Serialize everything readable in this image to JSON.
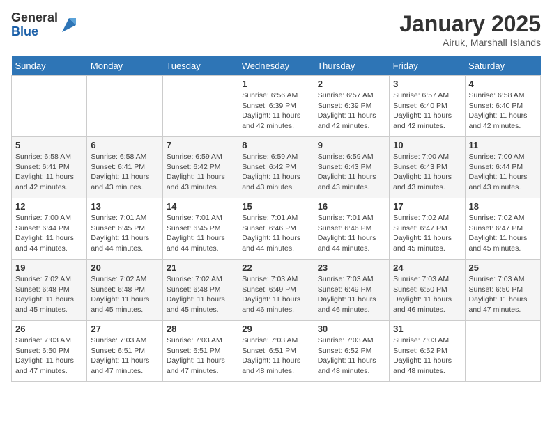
{
  "header": {
    "logo_general": "General",
    "logo_blue": "Blue",
    "month_title": "January 2025",
    "location": "Airuk, Marshall Islands"
  },
  "days_of_week": [
    "Sunday",
    "Monday",
    "Tuesday",
    "Wednesday",
    "Thursday",
    "Friday",
    "Saturday"
  ],
  "weeks": [
    [
      {
        "day": "",
        "info": ""
      },
      {
        "day": "",
        "info": ""
      },
      {
        "day": "",
        "info": ""
      },
      {
        "day": "1",
        "info": "Sunrise: 6:56 AM\nSunset: 6:39 PM\nDaylight: 11 hours and 42 minutes."
      },
      {
        "day": "2",
        "info": "Sunrise: 6:57 AM\nSunset: 6:39 PM\nDaylight: 11 hours and 42 minutes."
      },
      {
        "day": "3",
        "info": "Sunrise: 6:57 AM\nSunset: 6:40 PM\nDaylight: 11 hours and 42 minutes."
      },
      {
        "day": "4",
        "info": "Sunrise: 6:58 AM\nSunset: 6:40 PM\nDaylight: 11 hours and 42 minutes."
      }
    ],
    [
      {
        "day": "5",
        "info": "Sunrise: 6:58 AM\nSunset: 6:41 PM\nDaylight: 11 hours and 42 minutes."
      },
      {
        "day": "6",
        "info": "Sunrise: 6:58 AM\nSunset: 6:41 PM\nDaylight: 11 hours and 43 minutes."
      },
      {
        "day": "7",
        "info": "Sunrise: 6:59 AM\nSunset: 6:42 PM\nDaylight: 11 hours and 43 minutes."
      },
      {
        "day": "8",
        "info": "Sunrise: 6:59 AM\nSunset: 6:42 PM\nDaylight: 11 hours and 43 minutes."
      },
      {
        "day": "9",
        "info": "Sunrise: 6:59 AM\nSunset: 6:43 PM\nDaylight: 11 hours and 43 minutes."
      },
      {
        "day": "10",
        "info": "Sunrise: 7:00 AM\nSunset: 6:43 PM\nDaylight: 11 hours and 43 minutes."
      },
      {
        "day": "11",
        "info": "Sunrise: 7:00 AM\nSunset: 6:44 PM\nDaylight: 11 hours and 43 minutes."
      }
    ],
    [
      {
        "day": "12",
        "info": "Sunrise: 7:00 AM\nSunset: 6:44 PM\nDaylight: 11 hours and 44 minutes."
      },
      {
        "day": "13",
        "info": "Sunrise: 7:01 AM\nSunset: 6:45 PM\nDaylight: 11 hours and 44 minutes."
      },
      {
        "day": "14",
        "info": "Sunrise: 7:01 AM\nSunset: 6:45 PM\nDaylight: 11 hours and 44 minutes."
      },
      {
        "day": "15",
        "info": "Sunrise: 7:01 AM\nSunset: 6:46 PM\nDaylight: 11 hours and 44 minutes."
      },
      {
        "day": "16",
        "info": "Sunrise: 7:01 AM\nSunset: 6:46 PM\nDaylight: 11 hours and 44 minutes."
      },
      {
        "day": "17",
        "info": "Sunrise: 7:02 AM\nSunset: 6:47 PM\nDaylight: 11 hours and 45 minutes."
      },
      {
        "day": "18",
        "info": "Sunrise: 7:02 AM\nSunset: 6:47 PM\nDaylight: 11 hours and 45 minutes."
      }
    ],
    [
      {
        "day": "19",
        "info": "Sunrise: 7:02 AM\nSunset: 6:48 PM\nDaylight: 11 hours and 45 minutes."
      },
      {
        "day": "20",
        "info": "Sunrise: 7:02 AM\nSunset: 6:48 PM\nDaylight: 11 hours and 45 minutes."
      },
      {
        "day": "21",
        "info": "Sunrise: 7:02 AM\nSunset: 6:48 PM\nDaylight: 11 hours and 45 minutes."
      },
      {
        "day": "22",
        "info": "Sunrise: 7:03 AM\nSunset: 6:49 PM\nDaylight: 11 hours and 46 minutes."
      },
      {
        "day": "23",
        "info": "Sunrise: 7:03 AM\nSunset: 6:49 PM\nDaylight: 11 hours and 46 minutes."
      },
      {
        "day": "24",
        "info": "Sunrise: 7:03 AM\nSunset: 6:50 PM\nDaylight: 11 hours and 46 minutes."
      },
      {
        "day": "25",
        "info": "Sunrise: 7:03 AM\nSunset: 6:50 PM\nDaylight: 11 hours and 47 minutes."
      }
    ],
    [
      {
        "day": "26",
        "info": "Sunrise: 7:03 AM\nSunset: 6:50 PM\nDaylight: 11 hours and 47 minutes."
      },
      {
        "day": "27",
        "info": "Sunrise: 7:03 AM\nSunset: 6:51 PM\nDaylight: 11 hours and 47 minutes."
      },
      {
        "day": "28",
        "info": "Sunrise: 7:03 AM\nSunset: 6:51 PM\nDaylight: 11 hours and 47 minutes."
      },
      {
        "day": "29",
        "info": "Sunrise: 7:03 AM\nSunset: 6:51 PM\nDaylight: 11 hours and 48 minutes."
      },
      {
        "day": "30",
        "info": "Sunrise: 7:03 AM\nSunset: 6:52 PM\nDaylight: 11 hours and 48 minutes."
      },
      {
        "day": "31",
        "info": "Sunrise: 7:03 AM\nSunset: 6:52 PM\nDaylight: 11 hours and 48 minutes."
      },
      {
        "day": "",
        "info": ""
      }
    ]
  ]
}
